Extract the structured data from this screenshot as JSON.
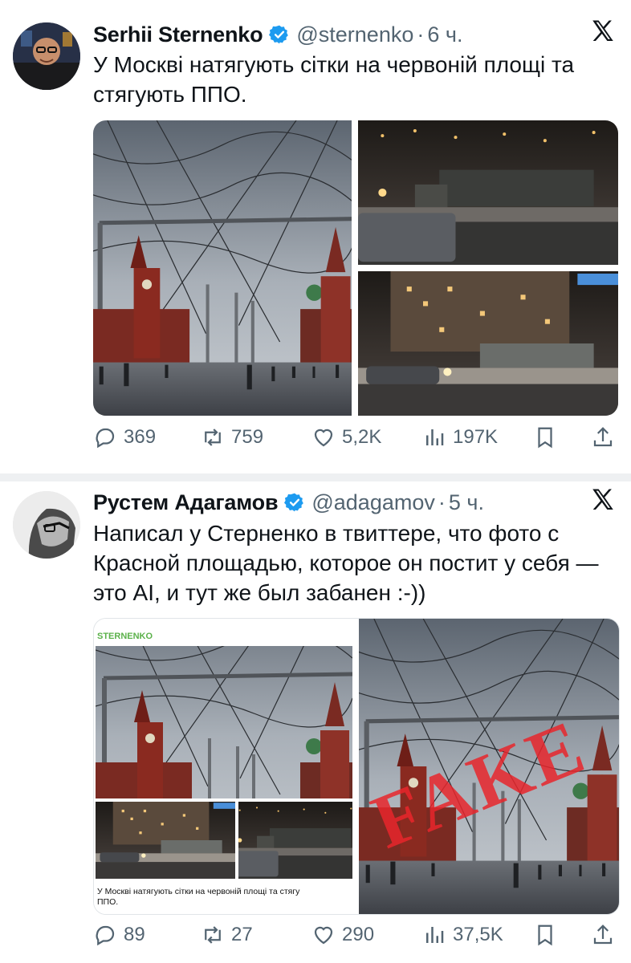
{
  "tweets": [
    {
      "name": "Serhii Sternenko",
      "handle": "@sternenko",
      "separator": "·",
      "time": "6 ч.",
      "text": "У Москві натягують сітки на червоній площі та\nстягують ППО.",
      "replies": "369",
      "retweets": "759",
      "likes": "5,2K",
      "views": "197K",
      "icons": [
        "verified-icon",
        "x-logo-icon",
        "reply-icon",
        "retweet-icon",
        "like-icon",
        "views-icon",
        "bookmark-icon",
        "share-icon"
      ]
    },
    {
      "name": "Рустем Адагамов",
      "handle": "@adagamov",
      "separator": "·",
      "time": "5 ч.",
      "text": "Написал у Стерненко в твиттере, что фото с\nКрасной площадью, которое он постит у себя —\nэто AI, и тут же был забанен :-))",
      "embedded_source": "STERNENKO",
      "embedded_caption": "У Москві натягують сітки на червоній площі та стягу\nППО.",
      "stamp": "FAKE",
      "replies": "89",
      "retweets": "27",
      "likes": "290",
      "views": "37,5K"
    }
  ],
  "colors": {
    "verified": "#1d9bf0",
    "muted": "#536471",
    "stamp": "#e8262b",
    "source": "#5bb14a"
  }
}
